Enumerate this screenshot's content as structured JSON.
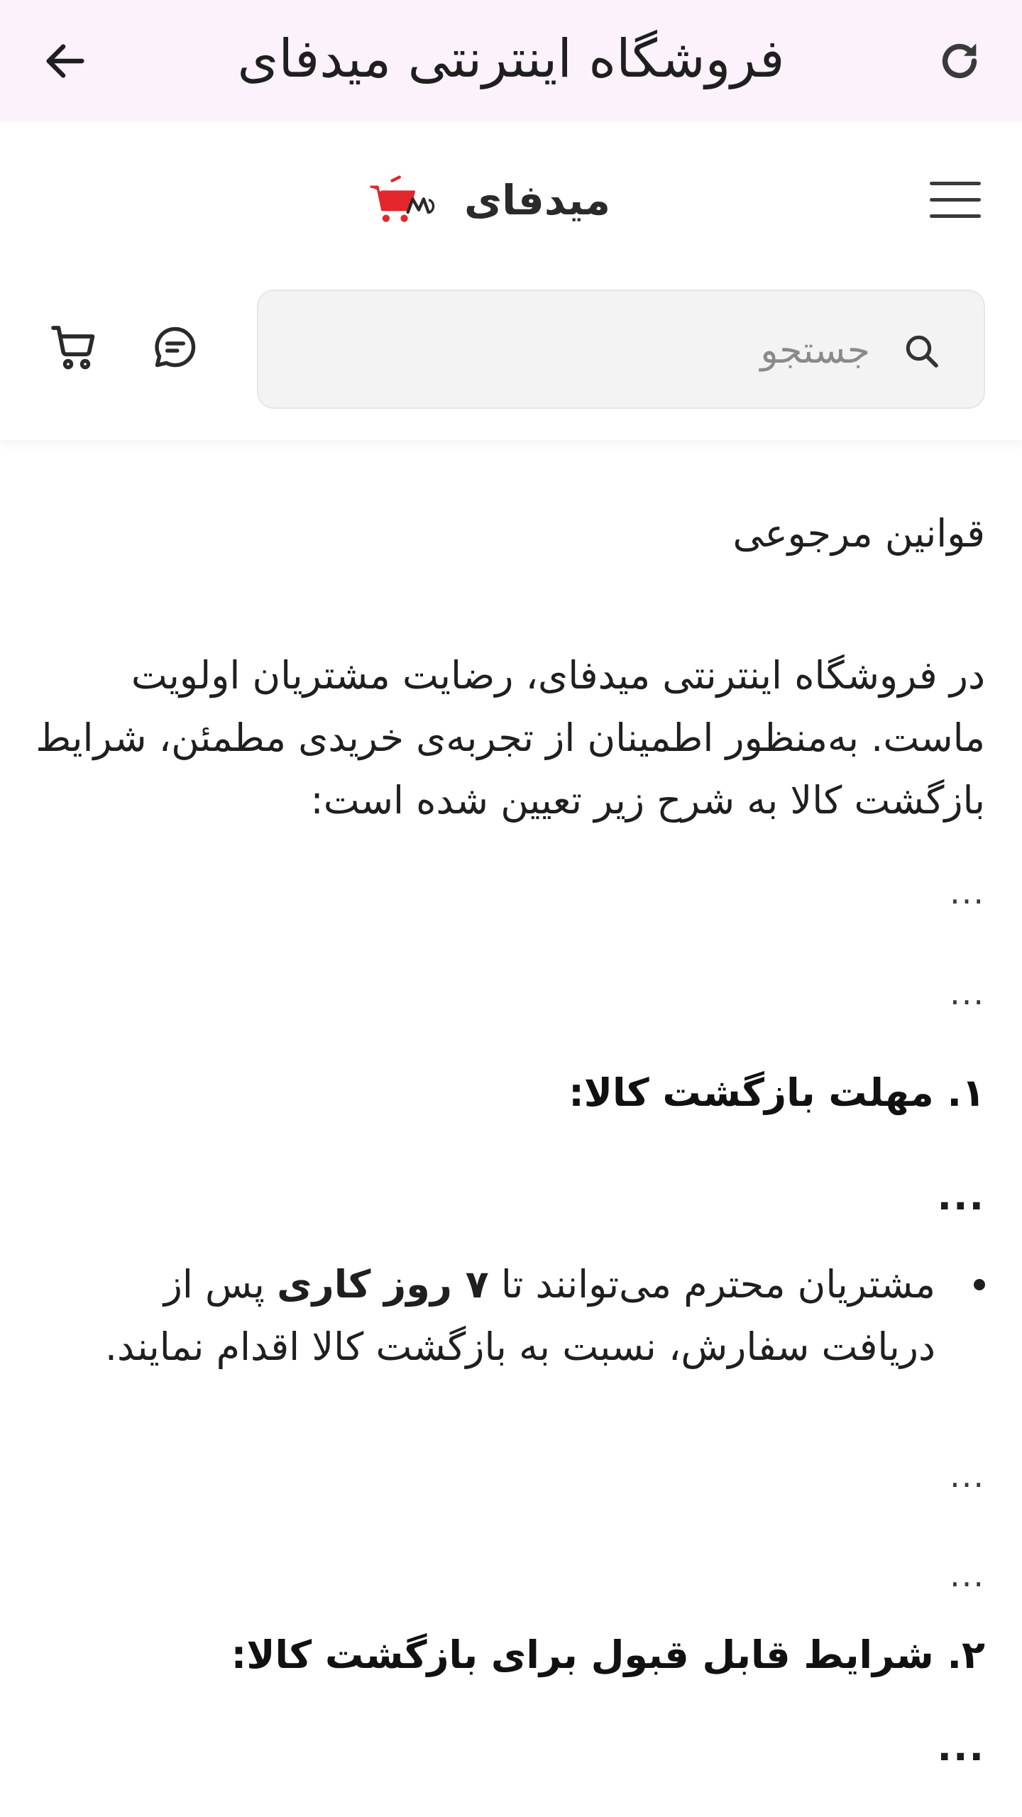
{
  "appbar": {
    "title": "فروشگاه اینترنتی میدفای",
    "back_icon": "arrow-left-icon",
    "refresh_icon": "refresh-icon"
  },
  "header": {
    "menu_icon": "hamburger-menu-icon",
    "logo_text": "میدفای",
    "logo_icon": "cart-logo-icon",
    "brand_color": "#e3262b",
    "search": {
      "placeholder": "جستجو"
    },
    "chat_icon": "chat-icon",
    "cart_icon": "cart-icon"
  },
  "content": {
    "heading": "قوانین مرجوعی",
    "intro_lines": [
      "در فروشگاه اینترنتی میدفای، رضایت مشتریان اولویت",
      "ماست. به‌منظور اطمینان از تجربه‌ی خریدی مطمئن، شرایط",
      "بازگشت کالا به شرح زیر تعیین شده است:"
    ],
    "ellipsis": "...",
    "section1_title": "۱. مهلت بازگشت کالا:",
    "bullet1": {
      "part1": "مشتریان محترم می‌توانند تا",
      "bold": "۷ روز کاری",
      "part2": "پس از",
      "line2": "دریافت سفارش، نسبت به بازگشت کالا اقدام نمایند."
    },
    "section2_title": "۲. شرایط قابل قبول برای بازگشت کالا:"
  }
}
